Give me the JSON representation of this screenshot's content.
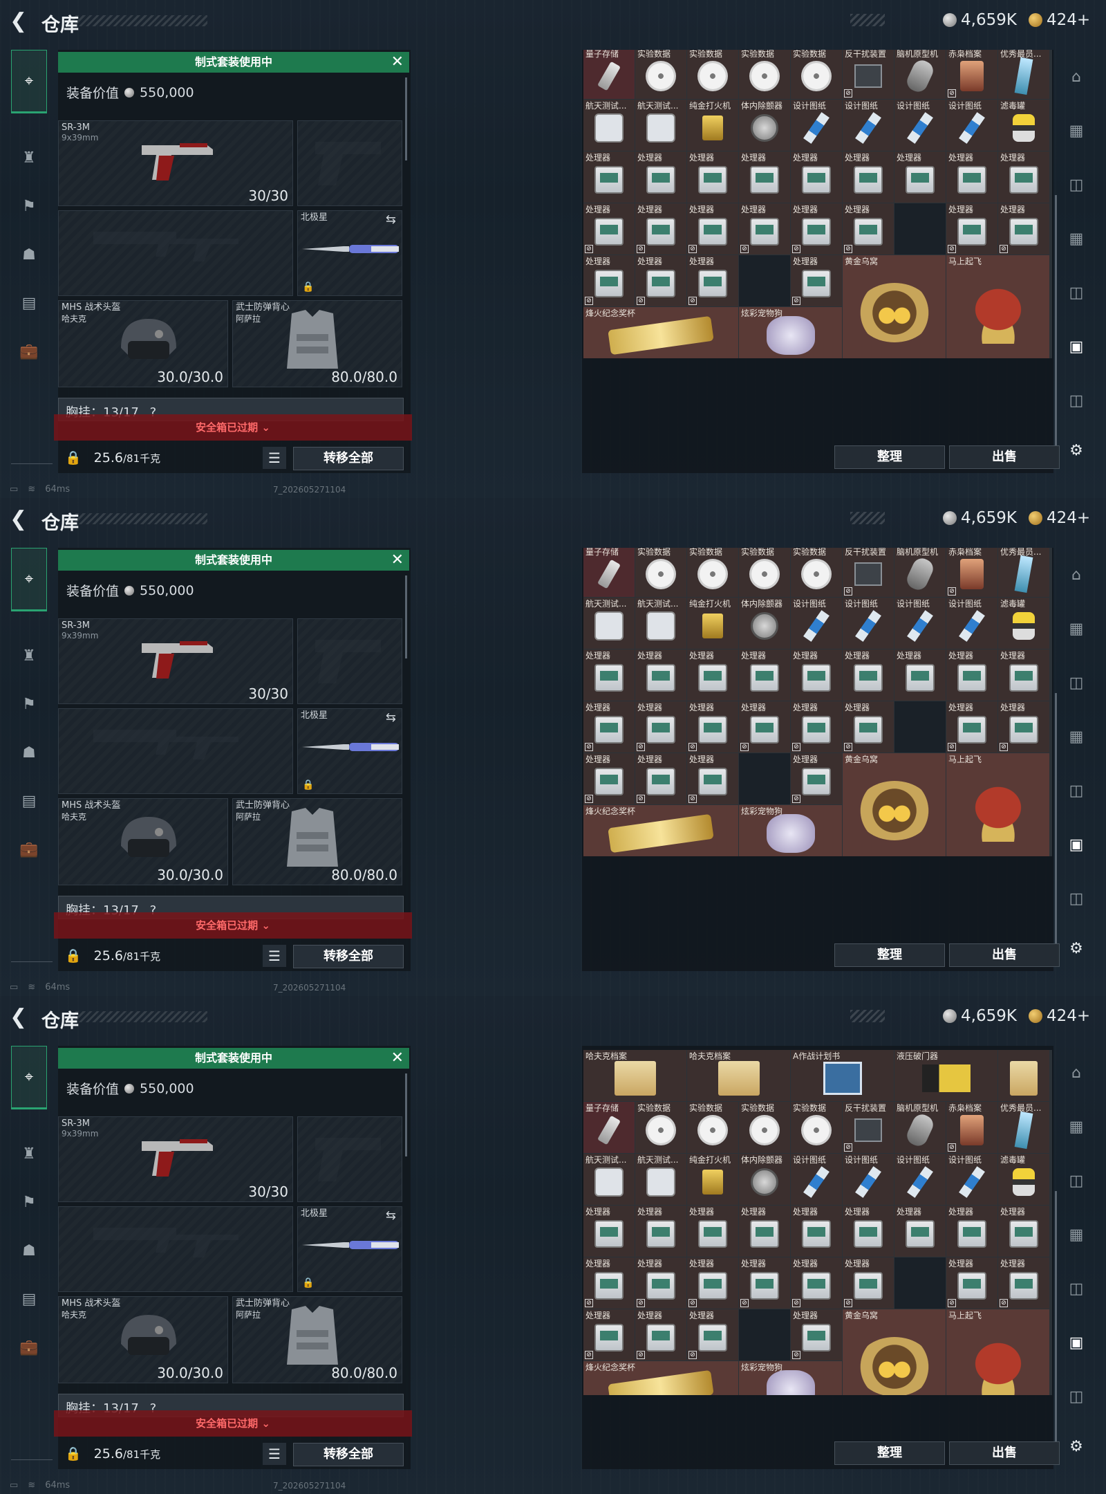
{
  "header": {
    "title": "仓库",
    "silver": "4,659K",
    "gold": "424+"
  },
  "loadout": {
    "banner": "制式套装使用中",
    "equip_value_label": "装备价值",
    "equip_value": "550,000",
    "primary": {
      "name": "SR-3M",
      "caliber": "9x39mm",
      "ammo": "30/30"
    },
    "melee": {
      "name": "北极星"
    },
    "helmet": {
      "line1": "MHS 战术头盔",
      "line2": "哈夫克",
      "durability": "30.0/30.0"
    },
    "armor": {
      "line1": "武士防弹背心",
      "line2": "阿萨拉",
      "durability": "80.0/80.0"
    },
    "chest_label": "胸挂：13/17",
    "chest_help": "?",
    "safe_box": "安全箱已过期",
    "weight": "25.6",
    "weight_max": "/81千克",
    "transfer_all": "转移全部"
  },
  "stash": {
    "sort": "整理",
    "sell": "出售",
    "row0": [
      {
        "n": "哈夫克档案"
      },
      {
        "n": "哈夫克档案"
      },
      {
        "n": "A作战计划书"
      },
      {
        "n": "液压破门器"
      }
    ],
    "row1": [
      {
        "n": "量子存储"
      },
      {
        "n": "实验数据"
      },
      {
        "n": "实验数据"
      },
      {
        "n": "实验数据"
      },
      {
        "n": "实验数据"
      },
      {
        "n": "反干扰装置"
      },
      {
        "n": "脑机原型机"
      },
      {
        "n": "赤枭档案"
      },
      {
        "n": "优秀最员..."
      }
    ],
    "row2": [
      {
        "n": "航天测试..."
      },
      {
        "n": "航天测试..."
      },
      {
        "n": "纯金打火机"
      },
      {
        "n": "体内除颤器"
      },
      {
        "n": "设计图纸"
      },
      {
        "n": "设计图纸"
      },
      {
        "n": "设计图纸"
      },
      {
        "n": "设计图纸"
      },
      {
        "n": "滤毒罐"
      }
    ],
    "processor": "处理器",
    "nest": "黄金乌窝",
    "horse": "马上起飞",
    "trophy": "烽火纪念奖杯",
    "statue": "炫彩宠物狗"
  },
  "status": {
    "ping": "64ms",
    "build": "7_202605271104"
  }
}
